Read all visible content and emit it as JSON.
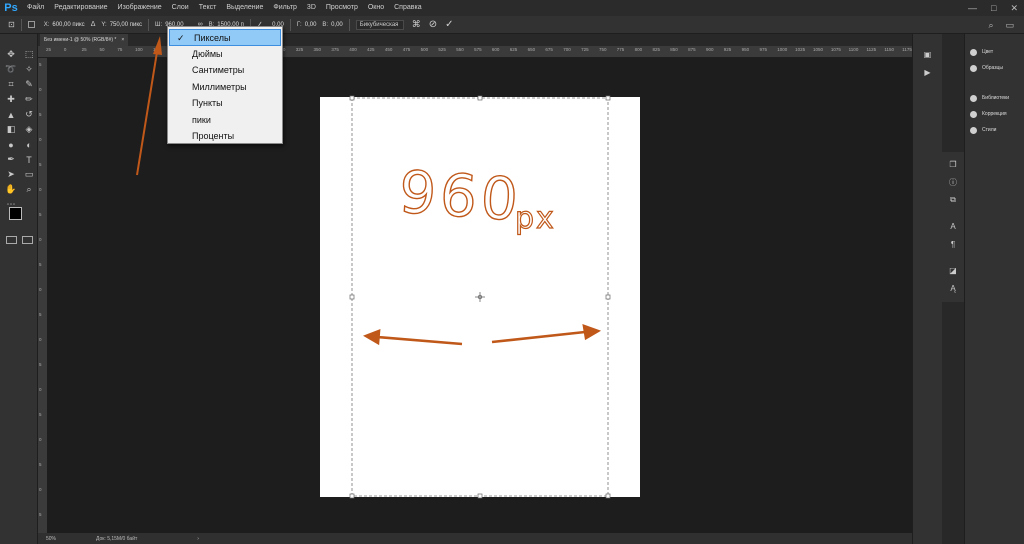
{
  "app": {
    "logo": "Ps",
    "menu": [
      "Файл",
      "Редактирование",
      "Изображение",
      "Слои",
      "Текст",
      "Выделение",
      "Фильтр",
      "3D",
      "Просмотр",
      "Окно",
      "Справка"
    ],
    "window_controls": [
      "—",
      "□",
      "✕"
    ]
  },
  "options_bar": {
    "x_label": "X:",
    "x_value": "600,00 пикс",
    "y_label": "Y:",
    "y_value": "750,00 пикс",
    "w_label": "Ш:",
    "w_value": "960,00",
    "h_label": "В:",
    "h_value": "1500,00 п",
    "angle_value": "0,00",
    "h_skew_label": "Г:",
    "h_skew_value": "0,00",
    "v_skew_label": "В:",
    "v_skew_value": "0,00",
    "interpolation": "Бикубическая"
  },
  "unit_dropdown": {
    "items": [
      "Пикселы",
      "Дюймы",
      "Сантиметры",
      "Миллиметры",
      "Пункты",
      "пики",
      "Проценты"
    ],
    "selected_index": 0
  },
  "document": {
    "tab_title": "Без имени-1 @ 50% (RGB/8#) *",
    "tab_close": "×",
    "annotation_text": "960",
    "annotation_unit": "px",
    "annotation_color": "#c0581a"
  },
  "rulers": {
    "top_ticks": [
      "25",
      "0",
      "25",
      "50",
      "75",
      "100",
      "125",
      "150",
      "175",
      "200",
      "225",
      "250",
      "275",
      "300",
      "325",
      "350",
      "375",
      "400",
      "425",
      "450",
      "475",
      "500",
      "525",
      "550",
      "575",
      "600",
      "625",
      "650",
      "675",
      "700",
      "725",
      "750",
      "775",
      "800",
      "825",
      "850",
      "875",
      "900",
      "925",
      "950",
      "975",
      "1000",
      "1025",
      "1050",
      "1075",
      "1100",
      "1125",
      "1150",
      "1175"
    ],
    "left_ticks": [
      "5",
      "0",
      "5",
      "0",
      "5",
      "0",
      "5",
      "0",
      "5",
      "0",
      "5",
      "0",
      "5",
      "0",
      "5",
      "0",
      "5",
      "0",
      "5"
    ]
  },
  "status": {
    "zoom": "50%",
    "doc_info": "Док: 5,15М/0 байт",
    "arrow": "›"
  },
  "panels": {
    "items": [
      {
        "label": "Цвет",
        "icon": "color-icon"
      },
      {
        "label": "Образцы",
        "icon": "swatches-icon"
      },
      {
        "label": "Библиотеки",
        "icon": "libraries-icon"
      },
      {
        "label": "Коррекция",
        "icon": "adjustments-icon"
      },
      {
        "label": "Стили",
        "icon": "styles-icon"
      }
    ]
  },
  "colors": {
    "accent": "#31a8ff",
    "arrow": "#c0581a",
    "dropdown_selected": "#91c9f7"
  }
}
